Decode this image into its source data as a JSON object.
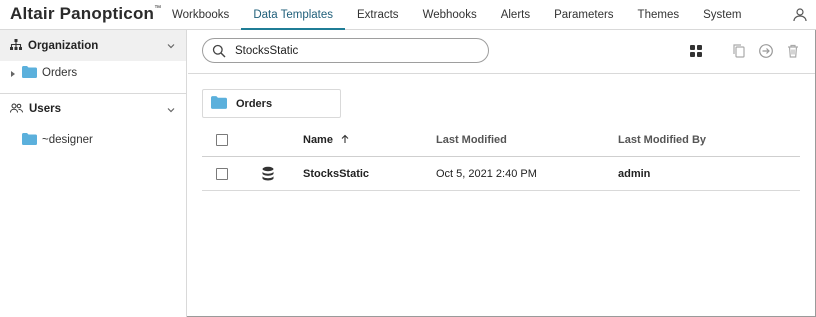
{
  "brand": {
    "name": "Altair Panopticon",
    "tm": "™"
  },
  "nav": {
    "tabs": [
      {
        "label": "Workbooks"
      },
      {
        "label": "Data Templates",
        "active": true
      },
      {
        "label": "Extracts"
      },
      {
        "label": "Webhooks"
      },
      {
        "label": "Alerts"
      },
      {
        "label": "Parameters"
      },
      {
        "label": "Themes"
      },
      {
        "label": "System"
      }
    ],
    "user_icon": "person-outline-icon"
  },
  "sidebar": {
    "organization": {
      "label": "Organization",
      "icon": "hierarchy-icon",
      "items": [
        {
          "label": "Orders",
          "icon": "folder-icon",
          "expandable": true
        }
      ]
    },
    "users": {
      "label": "Users",
      "icon": "users-icon",
      "items": [
        {
          "label": "~designer",
          "icon": "folder-icon"
        }
      ]
    }
  },
  "toolbar": {
    "search": {
      "value": "StocksStatic",
      "placeholder": "Search",
      "icon": "search-icon"
    },
    "actions": [
      {
        "name": "grid-view",
        "icon": "grid-icon"
      },
      {
        "name": "copy",
        "icon": "copy-icon"
      },
      {
        "name": "move",
        "icon": "arrow-circle-icon"
      },
      {
        "name": "delete",
        "icon": "trash-icon"
      }
    ]
  },
  "folder_chip": {
    "label": "Orders",
    "icon": "folder-icon"
  },
  "table": {
    "columns": {
      "name": "Name",
      "last_modified": "Last Modified",
      "last_modified_by": "Last Modified By"
    },
    "sort": {
      "column": "name",
      "direction": "asc"
    },
    "rows": [
      {
        "icon": "database-icon",
        "name": "StocksStatic",
        "last_modified": "Oct 5, 2021 2:40 PM",
        "last_modified_by": "admin"
      }
    ]
  },
  "colors": {
    "accent": "#1f7d96",
    "folder": "#5bb0dc",
    "border": "#d9d9d9"
  }
}
